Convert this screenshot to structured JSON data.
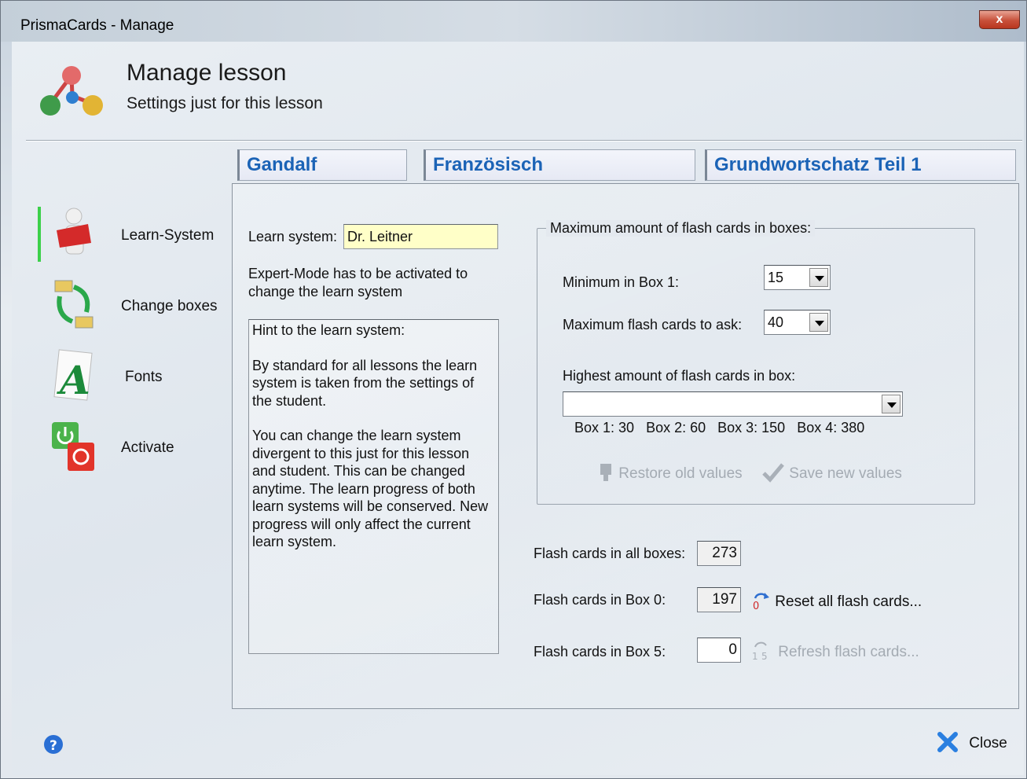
{
  "window": {
    "title": "PrismaCards - Manage",
    "close_glyph": "x"
  },
  "header": {
    "title": "Manage lesson",
    "subtitle": "Settings just for this lesson"
  },
  "breadcrumb": [
    "Gandalf",
    "Französisch",
    "Grundwortschatz Teil 1"
  ],
  "nav": [
    {
      "label": "Learn-System",
      "icon": "teacher-icon",
      "active": true
    },
    {
      "label": "Change boxes",
      "icon": "change-boxes-icon",
      "active": false
    },
    {
      "label": "Fonts",
      "icon": "fonts-icon",
      "active": false
    },
    {
      "label": "Activate",
      "icon": "activate-icon",
      "active": false
    }
  ],
  "learn": {
    "system_label": "Learn system:",
    "system_value": "Dr. Leitner",
    "expert_note": "Expert-Mode has to be activated to change the learn system",
    "hint_title": "Hint to the learn system:",
    "hint_p1": "By standard for all lessons the learn system is taken from the settings of the student.",
    "hint_p2": "You can change the learn system divergent to this just for this lesson and student. This can be changed anytime. The learn progress of both learn systems will be conserved. New progress will only affect the current learn system."
  },
  "boxes": {
    "legend": "Maximum amount of flash cards in boxes:",
    "min_box1_label": "Minimum in Box 1:",
    "min_box1_value": "15",
    "max_ask_label": "Maximum flash cards to ask:",
    "max_ask_value": "40",
    "highest_label": "Highest amount of flash cards in box:",
    "highest_value": "Box 1: 30   Box 2: 60   Box 3: 150   Box 4: 380",
    "restore_label": "Restore old values",
    "save_label": "Save new values"
  },
  "stats": {
    "all_label": "Flash cards in all boxes:",
    "all_value": "273",
    "box0_label": "Flash cards in Box 0:",
    "box0_value": "197",
    "reset_label": "Reset all flash cards...",
    "box5_label": "Flash cards in Box 5:",
    "box5_value": "0",
    "refresh_label": "Refresh flash cards..."
  },
  "footer": {
    "close_label": "Close"
  },
  "colors": {
    "accent": "#1b63b6",
    "active_bar": "#3cd04a",
    "input_highlight": "#ffffc8"
  }
}
